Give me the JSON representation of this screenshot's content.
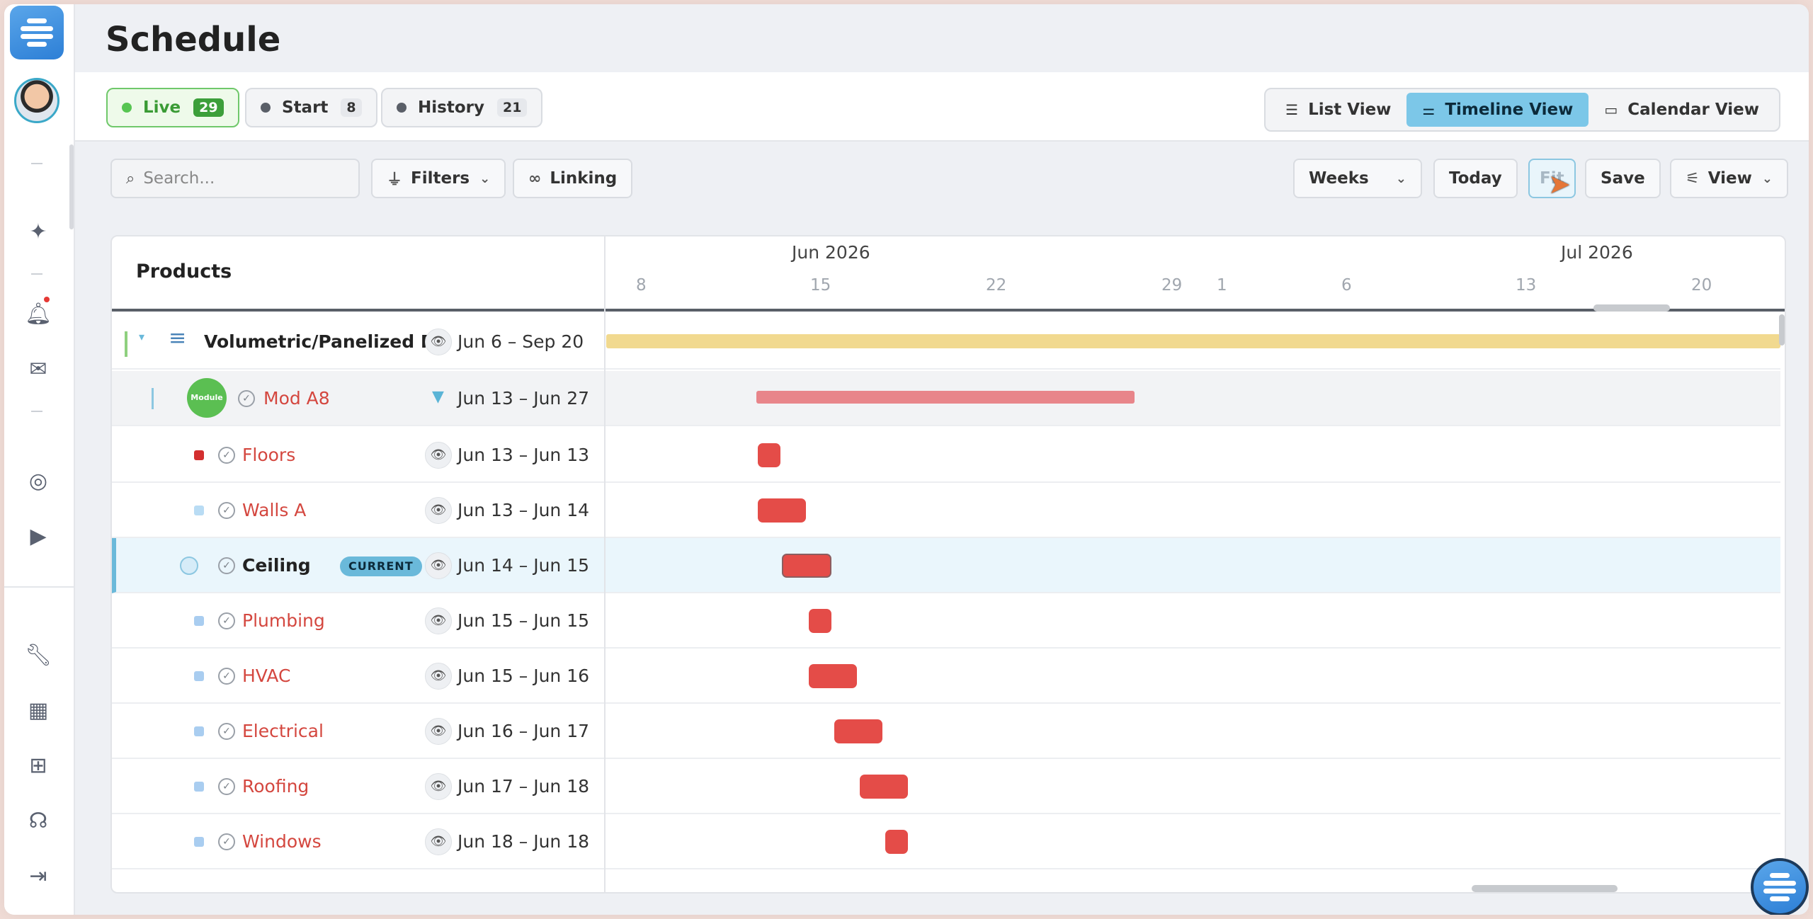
{
  "page": {
    "title": "Schedule"
  },
  "status_pills": [
    {
      "label": "Live",
      "count": "29"
    },
    {
      "label": "Start",
      "count": "8"
    },
    {
      "label": "History",
      "count": "21"
    }
  ],
  "view_tabs": [
    {
      "label": "List View",
      "icon": "list-icon"
    },
    {
      "label": "Timeline View",
      "icon": "timeline-icon",
      "active": true
    },
    {
      "label": "Calendar View",
      "icon": "calendar-icon"
    }
  ],
  "toolbar": {
    "search_placeholder": "Search...",
    "filters_label": "Filters",
    "linking_label": "Linking",
    "scale_label": "Weeks",
    "today_label": "Today",
    "fit_label": "Fit",
    "save_label": "Save",
    "view_label": "View"
  },
  "gantt": {
    "column_header": "Products",
    "months": [
      "Jun 2026",
      "Jul 2026"
    ],
    "days": [
      "8",
      "15",
      "22",
      "29",
      "1",
      "6",
      "13",
      "20"
    ],
    "rows": [
      {
        "name": "Volumetric/Panelized P...",
        "dates": "Jun 6 – Sep 20"
      },
      {
        "name": "Mod A8",
        "dates": "Jun 13 – Jun 27",
        "badge": "Module"
      },
      {
        "name": "Floors",
        "dates": "Jun 13 – Jun 13"
      },
      {
        "name": "Walls A",
        "dates": "Jun 13 – Jun 14"
      },
      {
        "name": "Ceiling",
        "dates": "Jun 14 – Jun 15",
        "tag": "CURRENT"
      },
      {
        "name": "Plumbing",
        "dates": "Jun 15 – Jun 15"
      },
      {
        "name": "HVAC",
        "dates": "Jun 15 – Jun 16"
      },
      {
        "name": "Electrical",
        "dates": "Jun 16 – Jun 17"
      },
      {
        "name": "Roofing",
        "dates": "Jun 17 – Jun 18"
      },
      {
        "name": "Windows",
        "dates": "Jun 18 – Jun 18"
      }
    ]
  },
  "colors": {
    "accent": "#7cc7e8",
    "live_green": "#57c552",
    "task_red": "#e44c48",
    "project_bar": "#f1d98f",
    "module_bar": "#e8858a"
  }
}
